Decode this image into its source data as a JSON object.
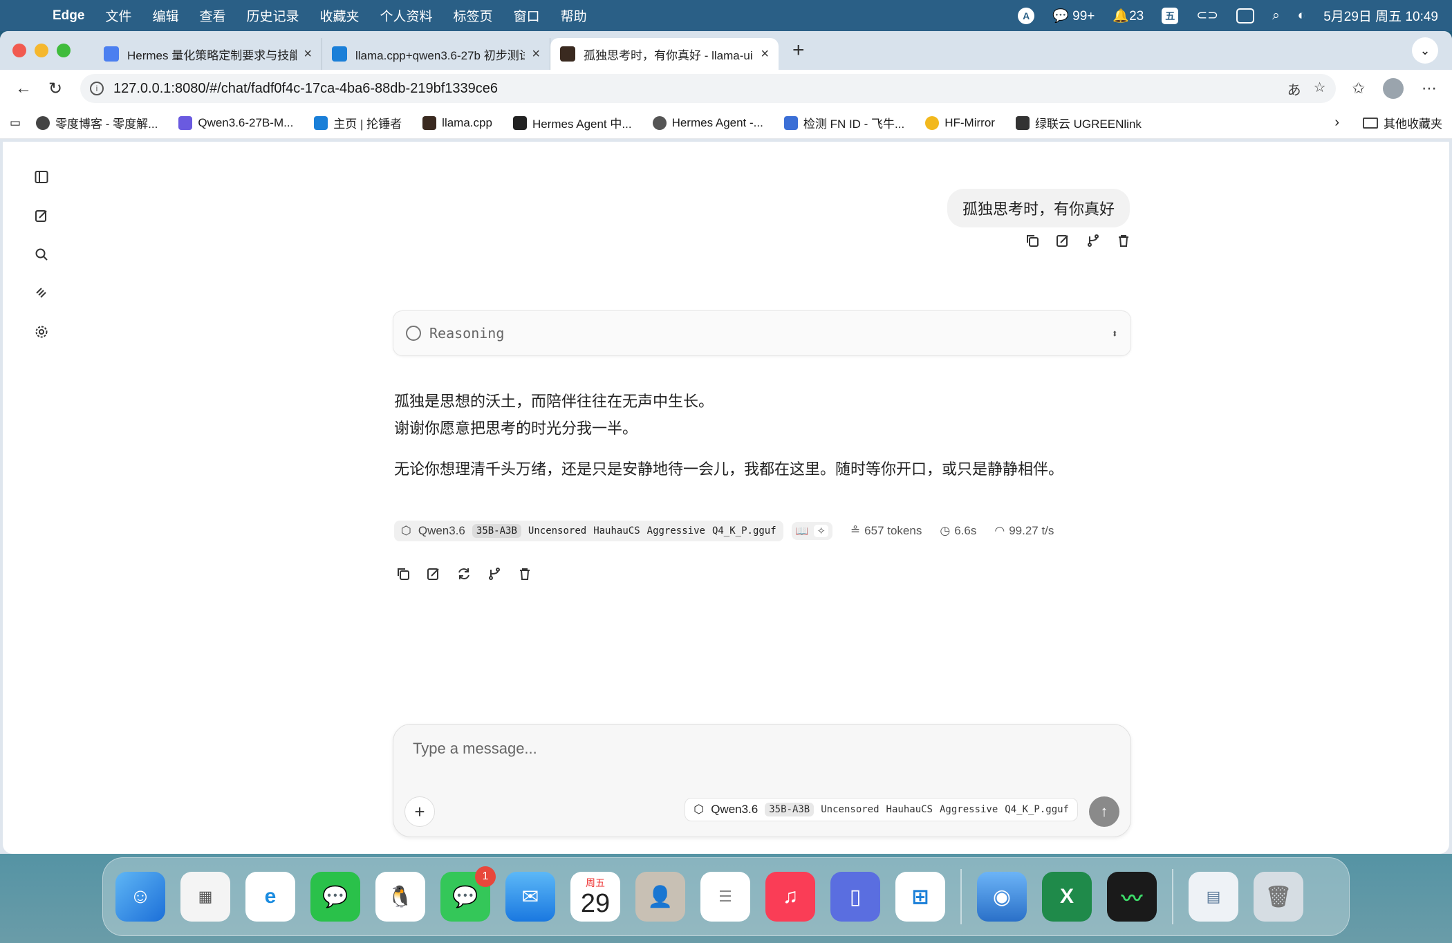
{
  "menubar": {
    "app": "Edge",
    "items": [
      "文件",
      "编辑",
      "查看",
      "历史记录",
      "收藏夹",
      "个人资料",
      "标签页",
      "窗口",
      "帮助"
    ],
    "wechat_count": "99+",
    "notify_count": "23",
    "input_method": "五",
    "datetime": "5月29日 周五 10:49"
  },
  "tabs": [
    {
      "title": "Hermes 量化策略定制要求与技能",
      "active": false,
      "color": "#4b7ff0"
    },
    {
      "title": "llama.cpp+qwen3.6-27b 初步测试",
      "active": false,
      "color": "#1a7fd8"
    },
    {
      "title": "孤独思考时，有你真好 - llama-ui",
      "active": true,
      "color": "#3a2a20"
    }
  ],
  "toolbar": {
    "url": "127.0.0.1:8080/#/chat/fadf0f4c-17ca-4ba6-88db-219bf1339ce6"
  },
  "bookmarks": [
    {
      "label": "零度博客 - 零度解...",
      "color": "#444"
    },
    {
      "label": "Qwen3.6-27B-M...",
      "color": "#6a5ae0"
    },
    {
      "label": "主页 | 抡锤者",
      "color": "#1a7fd8"
    },
    {
      "label": "llama.cpp",
      "color": "#3a2a20"
    },
    {
      "label": "Hermes Agent 中...",
      "color": "#222"
    },
    {
      "label": "Hermes Agent -...",
      "color": "#555"
    },
    {
      "label": "检测 FN ID - 飞牛...",
      "color": "#3b6fd6"
    },
    {
      "label": "HF-Mirror",
      "color": "#f2b81d"
    },
    {
      "label": "绿联云 UGREENlink",
      "color": "#333"
    }
  ],
  "bookmarks_other": "其他收藏夹",
  "chat": {
    "user_message": "孤独思考时，有你真好",
    "reasoning_label": "Reasoning",
    "assistant_paragraphs": [
      "孤独是思想的沃土，而陪伴往往在无声中生长。\n谢谢你愿意把思考的时光分我一半。",
      "无论你想理清千头万绪，还是只是安静地待一会儿，我都在这里。随时等你开口，或只是静静相伴。"
    ],
    "model": {
      "name": "Qwen3.6",
      "tags": [
        "35B-A3B",
        "Uncensored",
        "HauhauCS",
        "Aggressive",
        "Q4_K_P.gguf"
      ]
    },
    "stats": {
      "tokens": "657 tokens",
      "time": "6.6s",
      "speed": "99.27 t/s"
    }
  },
  "composer": {
    "placeholder": "Type a message..."
  },
  "dock": {
    "messages_badge": "1",
    "calendar_weekday": "周五",
    "calendar_day": "29"
  }
}
